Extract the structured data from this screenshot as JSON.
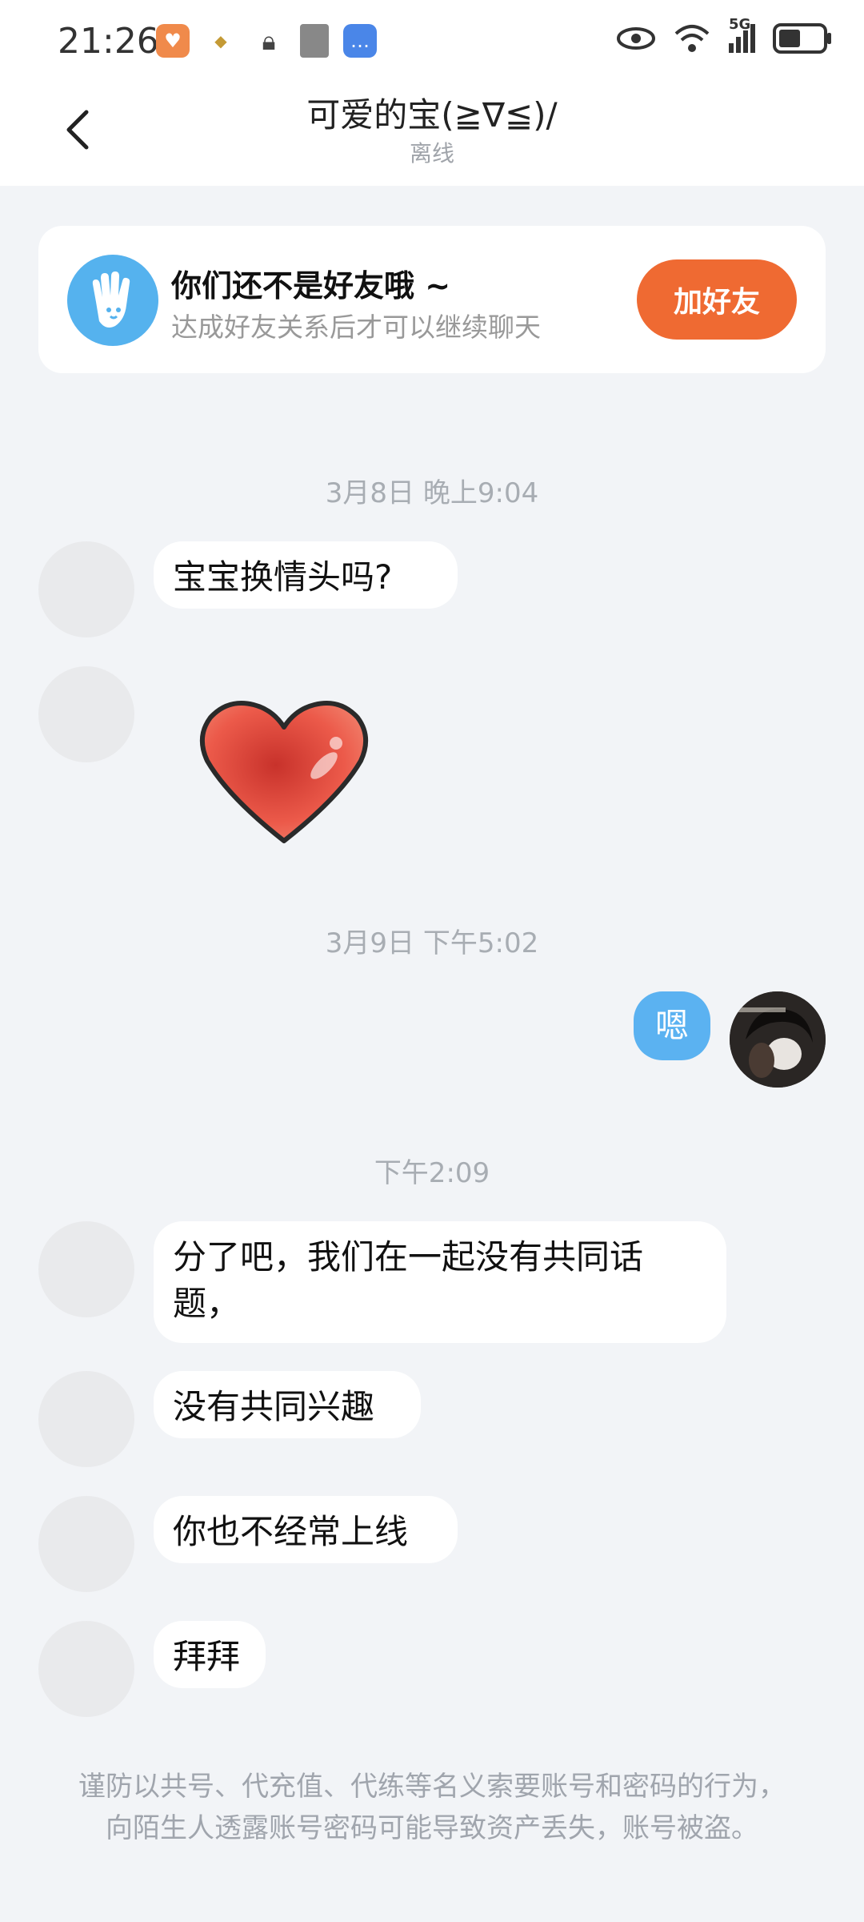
{
  "status_bar": {
    "time": "21:26",
    "network": "5G",
    "icons": [
      "health-app-icon",
      "honor-icon",
      "lock-icon",
      "book-icon",
      "message-icon",
      "eye-icon",
      "wifi-icon",
      "signal-icon",
      "battery-icon"
    ]
  },
  "header": {
    "title": "可爱的宝(≧∇≦)/",
    "subtitle": "离线"
  },
  "friend_card": {
    "title": "你们还不是好友哦 ~",
    "subtitle": "达成好友关系后才可以继续聊天",
    "button": "加好友"
  },
  "timestamps": [
    "3月8日 晚上9:04",
    "3月9日 下午5:02",
    "下午2:09"
  ],
  "messages": {
    "m1": "宝宝换情头吗?",
    "m3": "嗯",
    "m4": "分了吧，我们在一起没有共同话题，",
    "m5": "没有共同兴趣",
    "m6": "你也不经常上线",
    "m7": "拜拜"
  },
  "warning": "谨防以共号、代充值、代练等名义索要账号和密码的行为，向陌生人透露账号密码可能导致资产丢失，账号被盗。",
  "colors": {
    "accent_orange": "#ef6a32",
    "my_bubble": "#5bb2f1",
    "background": "#f2f4f7"
  }
}
